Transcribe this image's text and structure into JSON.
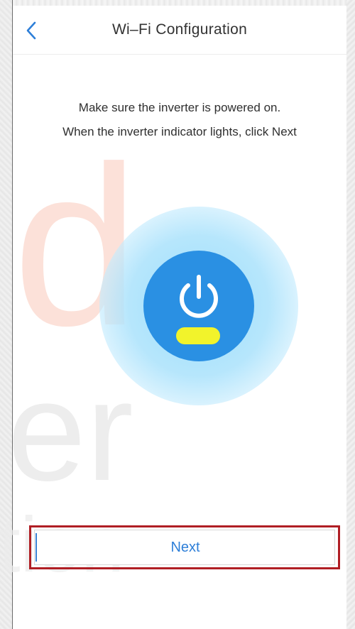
{
  "header": {
    "title": "Wi–Fi Configuration",
    "back_icon": "chevron-left-icon"
  },
  "instructions": {
    "line1": "Make sure the inverter is powered on.",
    "line2": "When the inverter indicator lights, click Next"
  },
  "illustration": {
    "icon": "power-icon",
    "indicator_color": "#f2f32b",
    "core_color": "#2a90e3",
    "halo_color": "#a9e1fb"
  },
  "footer": {
    "next_label": "Next"
  },
  "colors": {
    "accent": "#2e7fd8",
    "highlight_border": "#b01e24"
  }
}
